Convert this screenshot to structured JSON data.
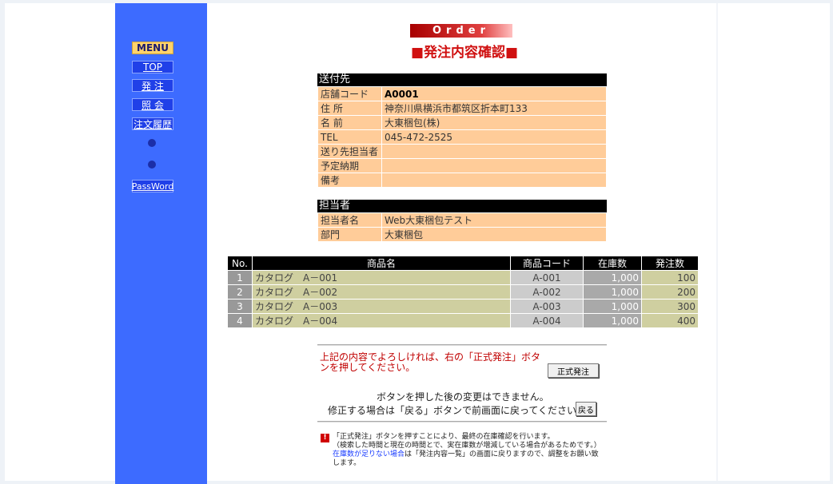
{
  "nav": {
    "menu": "MENU",
    "top": "TOP",
    "order": "発 注",
    "inquiry": "照 会",
    "history": "注文履歴",
    "password": "PassWord"
  },
  "header": {
    "banner": "Order",
    "title": "■発注内容確認■"
  },
  "shipping": {
    "heading": "送付先",
    "rows": [
      {
        "label": "店舗コード",
        "value": "A0001"
      },
      {
        "label": "住 所",
        "value": "神奈川県横浜市都筑区折本町133"
      },
      {
        "label": "名 前",
        "value": "大東梱包(株)"
      },
      {
        "label": "TEL",
        "value": "045-472-2525"
      },
      {
        "label": "送り先担当者",
        "value": ""
      },
      {
        "label": "予定納期",
        "value": ""
      },
      {
        "label": "備考",
        "value": ""
      }
    ]
  },
  "staff": {
    "heading": "担当者",
    "rows": [
      {
        "label": "担当者名",
        "value": "Web大東梱包テスト"
      },
      {
        "label": "部門",
        "value": "大東梱包"
      }
    ]
  },
  "items": {
    "headers": [
      "No.",
      "商品名",
      "商品コード",
      "在庫数",
      "発注数"
    ],
    "rows": [
      {
        "no": "1",
        "name": "カタログ　A－001",
        "code": "A-001",
        "stock": "1,000",
        "qty": "100"
      },
      {
        "no": "2",
        "name": "カタログ　A－002",
        "code": "A-002",
        "stock": "1,000",
        "qty": "200"
      },
      {
        "no": "3",
        "name": "カタログ　A－003",
        "code": "A-003",
        "stock": "1,000",
        "qty": "300"
      },
      {
        "no": "4",
        "name": "カタログ　A－004",
        "code": "A-004",
        "stock": "1,000",
        "qty": "400"
      }
    ]
  },
  "confirm": {
    "message": "上記の内容でよろしければ、右の「正式発注」ボタンを押してください。",
    "order_button": "正式発注",
    "note1": "ボタンを押した後の変更はできません。",
    "note2": "修正する場合は「戻る」ボタンで前画面に戻ってください。",
    "back_button": "戻る"
  },
  "warning": {
    "icon": "!",
    "line1": "「正式発注」ボタンを押すことにより、最終の在庫確認を行います。",
    "line2": "（検索した時間と現在の時間とで、実在庫数が増減している場合があるためです。）",
    "line3_blue": "在庫数が足りない場合",
    "line3_rest": "は「発注内容一覧」の画面に戻りますので、調整をお願い致します。"
  }
}
